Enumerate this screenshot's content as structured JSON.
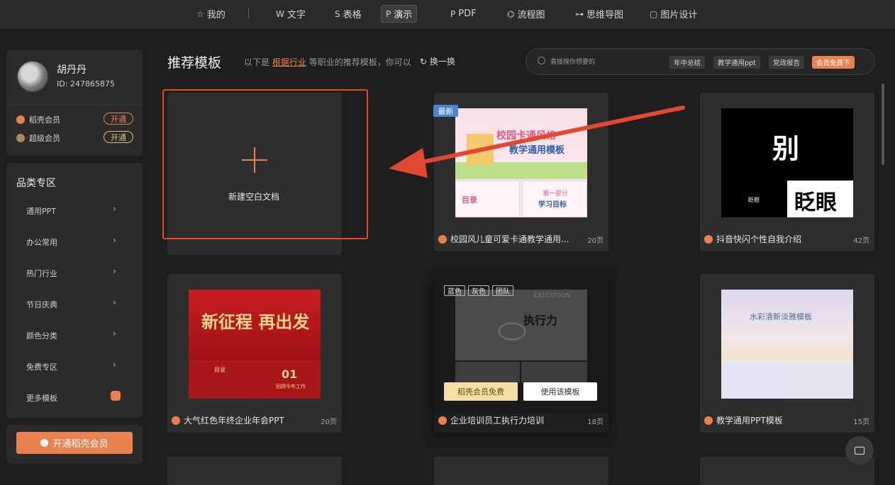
{
  "topbar": {
    "tabs": [
      {
        "icon": "☆",
        "label": "我的"
      },
      {
        "icon": "W",
        "label": "文字"
      },
      {
        "icon": "S",
        "label": "表格"
      },
      {
        "icon": "P",
        "label": "演示"
      },
      {
        "icon": "P",
        "label": "PDF"
      },
      {
        "icon": "⌬",
        "label": "流程图"
      },
      {
        "icon": "⊶",
        "label": "思维导图"
      },
      {
        "icon": "▢",
        "label": "图片设计"
      }
    ],
    "active_tab": "演示"
  },
  "profile": {
    "name": "胡丹丹",
    "id_text": "ID: 247865875",
    "memberships": [
      {
        "label": "稻壳会员",
        "button": "开通"
      },
      {
        "label": "超级会员",
        "button": "开通"
      }
    ]
  },
  "categories": {
    "title": "品类专区",
    "items": [
      "通用PPT",
      "办公常用",
      "热门行业",
      "节日庆典",
      "颜色分类",
      "免费专区",
      "更多模板"
    ]
  },
  "vip_button": "开通稻壳会员",
  "header": {
    "title": "推荐模板",
    "sub_prefix": "以下是",
    "sub_link": "根据行业",
    "sub_suffix": "等职业的推荐模板，你可以",
    "refresh": "换一换"
  },
  "search": {
    "placeholder": "直接搜你想要的",
    "chips": [
      "年中总结",
      "教学通用ppt",
      "党政报告",
      "会员免费下"
    ]
  },
  "blank": {
    "label": "新建空白文档"
  },
  "cards": [
    {
      "title": "校园风儿童可爱卡通教学通用...",
      "pages": "20页",
      "badge": "最新",
      "thumb_main": "校园卡通风格",
      "thumb_sub": "教学通用模板",
      "thumb_a": "目录",
      "thumb_b": "第一部分",
      "thumb_c": "学习目标"
    },
    {
      "title": "抖音快闪个性自我介绍",
      "pages": "42页",
      "thumb_big": "别",
      "thumb_small": "眨眼",
      "thumb_big2": "眨眼"
    },
    {
      "title": "大气红色年终企业年会PPT",
      "pages": "20页",
      "thumb_main": "新征程 再出发",
      "thumb_a": "目录",
      "thumb_b": "01",
      "thumb_c": "回顾今年工作"
    },
    {
      "title": "企业培训员工执行力培训",
      "pages": "18页",
      "tags": [
        "蓝色",
        "灰色",
        "团队"
      ],
      "thumb_main": "执行力",
      "thumb_en": "EXECUTION",
      "btn_free": "稻壳会员免费",
      "btn_use": "使用该模板"
    },
    {
      "title": "教学通用PPT模板",
      "pages": "15页",
      "thumb_main": "水彩清新淡雅模板"
    }
  ],
  "colors": {
    "accent": "#e9824f",
    "highlight": "#e0492f",
    "badge_blue": "#4a86d8"
  }
}
